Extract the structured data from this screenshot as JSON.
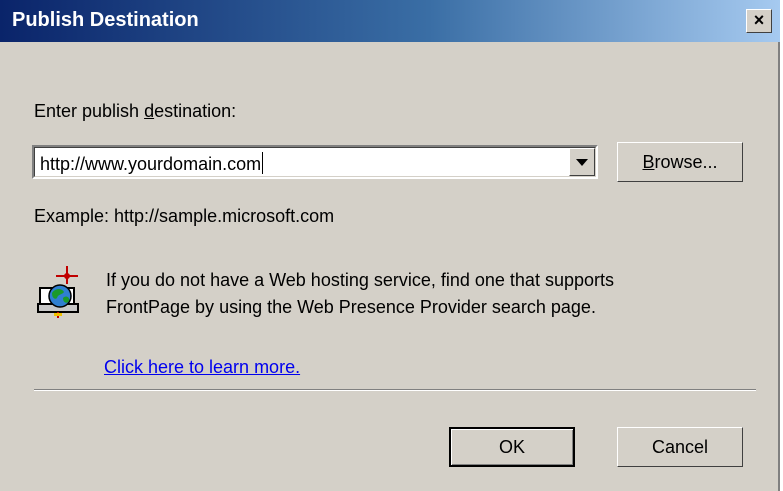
{
  "window": {
    "title": "Publish Destination",
    "close_label": "×"
  },
  "prompt": {
    "prefix": "Enter publish ",
    "mnemonic": "d",
    "suffix": "estination:"
  },
  "destination": {
    "value": "http://www.yourdomain.com"
  },
  "browse": {
    "mnemonic": "B",
    "rest": "rowse..."
  },
  "example_text": "Example: http://sample.microsoft.com",
  "info": {
    "line1": "If you do not have a Web hosting service, find one that supports",
    "line2": "FrontPage by using the Web Presence Provider search page.",
    "icon": "web-presence-icon"
  },
  "learn_more_link": "Click here to learn more.",
  "buttons": {
    "ok": "OK",
    "cancel": "Cancel"
  }
}
